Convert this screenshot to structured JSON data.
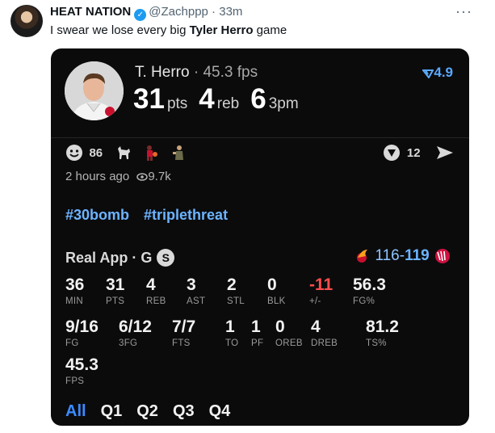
{
  "tweet": {
    "author_name": "HEAT NATION",
    "handle": "@Zachppp",
    "time": "33m",
    "more_icon": "more-horizontal-icon",
    "text_before": "I swear we lose every big ",
    "text_bold": "Tyler Herro",
    "text_after": " game"
  },
  "card": {
    "player_name": "T. Herro",
    "player_fps": "45.3 fps",
    "stat1_value": "31",
    "stat1_unit": "pts",
    "stat2_value": "4",
    "stat2_unit": "reb",
    "stat3_value": "6",
    "stat3_unit": "3pm",
    "rating": "4.9",
    "reaction_count": "86",
    "comment_count": "12",
    "time_ago": "2 hours ago",
    "views": "9.7k",
    "hashtags": [
      "#30bomb",
      "#triplethreat"
    ],
    "source": "Real App · G",
    "source_badge": "S",
    "score_home": "116",
    "score_sep": "-",
    "score_away": "119",
    "stats_row1": [
      {
        "value": "36",
        "label": "MIN"
      },
      {
        "value": "31",
        "label": "PTS"
      },
      {
        "value": "4",
        "label": "REB"
      },
      {
        "value": "3",
        "label": "AST"
      },
      {
        "value": "2",
        "label": "STL"
      },
      {
        "value": "0",
        "label": "BLK"
      },
      {
        "value": "-11",
        "label": "+/-"
      },
      {
        "value": "56.3",
        "label": "FG%"
      }
    ],
    "stats_row2": [
      {
        "value": "9/16",
        "label": "FG"
      },
      {
        "value": "6/12",
        "label": "3FG"
      },
      {
        "value": "7/7",
        "label": "FTS"
      },
      {
        "value": "1",
        "label": "TO"
      },
      {
        "value": "1",
        "label": "PF"
      },
      {
        "value": "0",
        "label": "OREB"
      },
      {
        "value": "4",
        "label": "DREB"
      },
      {
        "value": "81.2",
        "label": "TS%"
      }
    ],
    "stats_row3": [
      {
        "value": "45.3",
        "label": "FPS"
      }
    ],
    "quarter_tabs": [
      "All",
      "Q1",
      "Q2",
      "Q3",
      "Q4"
    ],
    "colors": {
      "accent": "#3b8bff",
      "negative": "#ff4d4d",
      "card_bg": "#0b0b0c"
    }
  }
}
